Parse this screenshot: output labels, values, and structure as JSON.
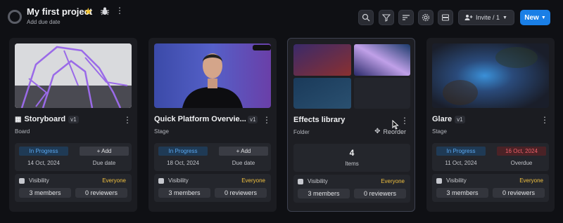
{
  "project": {
    "title": "My first project",
    "subtitle": "Add due date"
  },
  "toolbar": {
    "invite_label": "Invite / 1",
    "new_label": "New"
  },
  "icons": [
    "search-icon",
    "filter-icon",
    "sort-icon",
    "settings-icon",
    "layout-icon"
  ],
  "cards": [
    {
      "title": "Storyboard",
      "version": "v1",
      "type": "Board",
      "status": "In Progress",
      "status_date": "14 Oct, 2024",
      "right_badge": "+ Add",
      "right_sub": "Due date",
      "visibility": "Visibility",
      "visibility_value": "Everyone",
      "members": "3 members",
      "reviewers": "0 reviewers"
    },
    {
      "title": "Quick Platform Overvie...",
      "version": "v1",
      "type": "Stage",
      "status": "In Progress",
      "status_date": "18 Oct, 2024",
      "right_badge": "+ Add",
      "right_sub": "Due date",
      "visibility": "Visibility",
      "visibility_value": "Everyone",
      "members": "3 members",
      "reviewers": "0 reviewers"
    },
    {
      "title": "Effects library",
      "type": "Folder",
      "reorder": "Reorder",
      "items_count": "4",
      "items_label": "Items",
      "visibility": "Visibility",
      "visibility_value": "Everyone",
      "members": "3 members",
      "reviewers": "0 reviewers"
    },
    {
      "title": "Glare",
      "version": "v1",
      "type": "Stage",
      "status": "In Progress",
      "status_date": "11 Oct, 2024",
      "right_badge": "16 Oct, 2024",
      "right_sub": "Overdue",
      "visibility": "Visibility",
      "visibility_value": "Everyone",
      "members": "3 members",
      "reviewers": "0 reviewers"
    }
  ],
  "colors": {
    "accent": "#1a7fe6",
    "status_blue": "#5aa8f0",
    "overdue": "#f0606a",
    "everyone": "#f0c040"
  }
}
